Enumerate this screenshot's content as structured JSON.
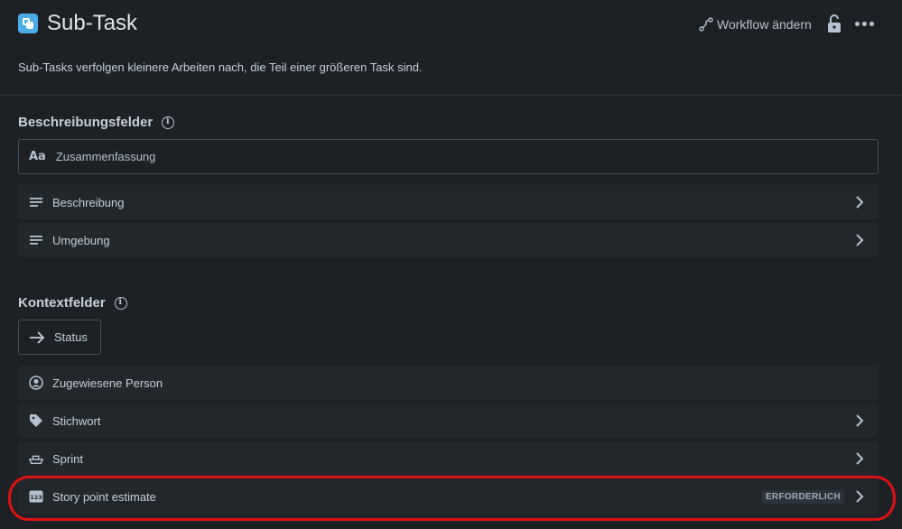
{
  "header": {
    "title": "Sub-Task",
    "workflow_label": "Workflow ändern",
    "description": "Sub-Tasks verfolgen kleinere Arbeiten nach, die Teil einer größeren Task sind."
  },
  "description_fields": {
    "title": "Beschreibungsfelder",
    "summary_field": {
      "icon": "text-aa-icon",
      "label": "Zusammenfassung"
    },
    "items": [
      {
        "icon": "text-lines-icon",
        "label": "Beschreibung"
      },
      {
        "icon": "text-lines-icon",
        "label": "Umgebung"
      }
    ]
  },
  "context_fields": {
    "title": "Kontextfelder",
    "status_field": {
      "icon": "arrow-right-icon",
      "label": "Status"
    },
    "items": [
      {
        "icon": "person-icon",
        "label": "Zugewiesene Person"
      },
      {
        "icon": "tag-icon",
        "label": "Stichwort"
      },
      {
        "icon": "sprint-icon",
        "label": "Sprint"
      },
      {
        "icon": "number-icon",
        "label": "Story point estimate",
        "badge": "ERFORDERLICH"
      }
    ]
  },
  "colors": {
    "background": "#1d2125",
    "row_background": "#22272b",
    "app_icon": "#4bade8",
    "highlight": "#e01010"
  }
}
